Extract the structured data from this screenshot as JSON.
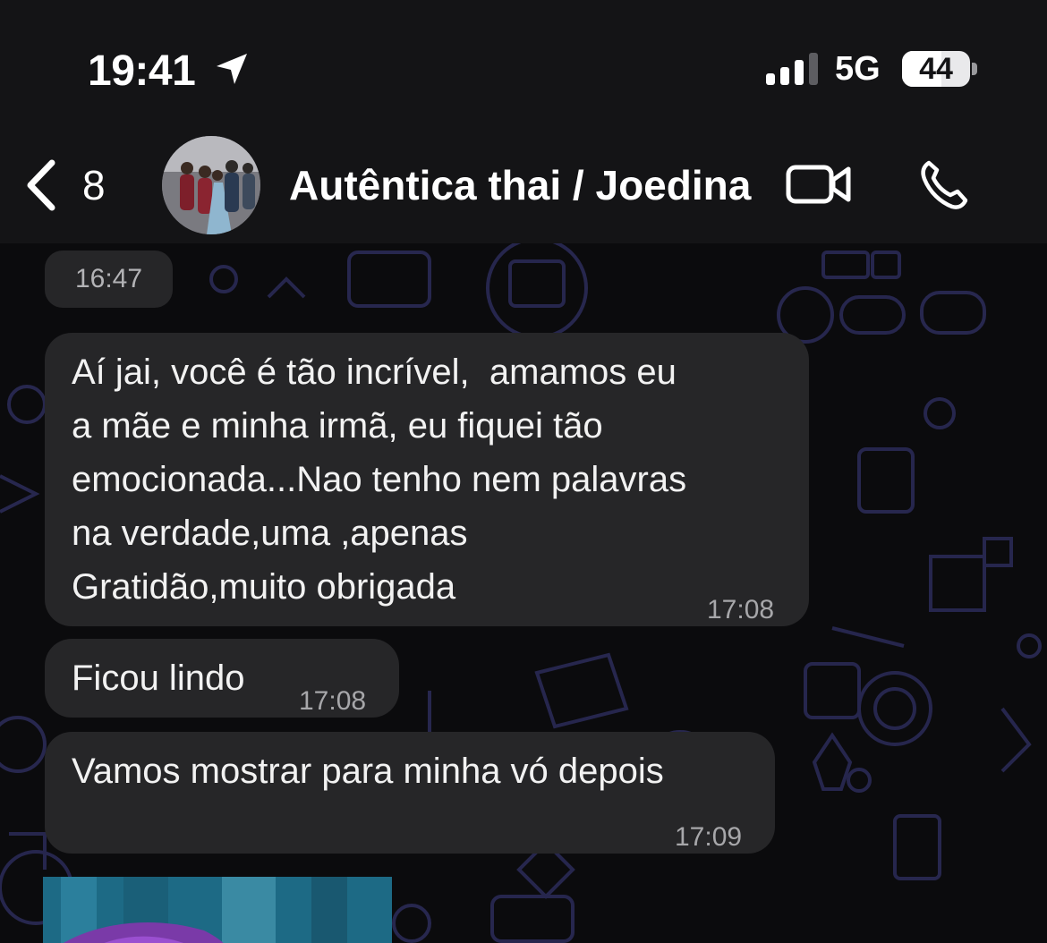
{
  "status_bar": {
    "time": "19:41",
    "network": "5G",
    "battery": "44",
    "location_icon": "location-arrow-icon",
    "signal_icon": "signal-bars-icon"
  },
  "header": {
    "back_count": "8",
    "title": "Autêntica thai / Joedina",
    "back_icon": "chevron-left-icon",
    "video_icon": "video-camera-icon",
    "call_icon": "phone-icon"
  },
  "messages": {
    "partial_time": "16:47",
    "m1": {
      "lines": [
        "Aí jai, você é tão incrível,  amamos eu",
        "a mãe e minha irmã, eu fiquei tão",
        "emocionada...Nao tenho nem palavras",
        "na verdade,uma ,apenas",
        "Gratidão,muito obrigada"
      ],
      "time": "17:08"
    },
    "m2": {
      "text": "Ficou lindo",
      "time": "17:08"
    },
    "m3": {
      "text": "Vamos mostrar para minha vó depois",
      "time": "17:09"
    }
  },
  "colors": {
    "background": "#0b0b0d",
    "header": "#141416",
    "bubble": "#262628",
    "pattern": "#2a2a55"
  }
}
